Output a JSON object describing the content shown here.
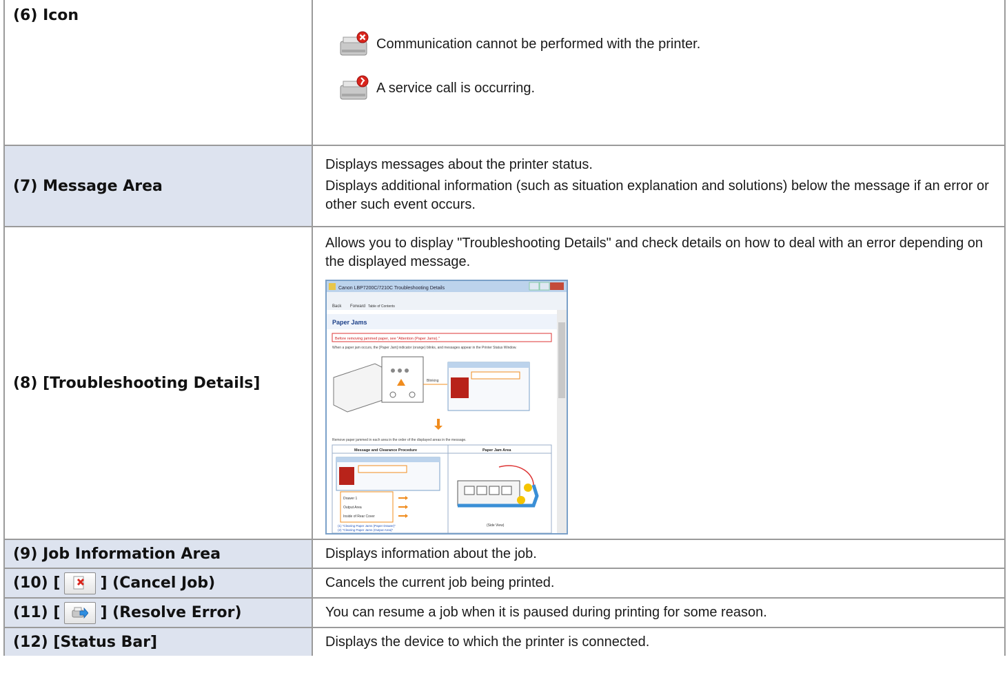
{
  "rows": {
    "icon": {
      "label": "(6) Icon",
      "items": [
        {
          "icon": "printer-error-x-icon",
          "text": "Communication cannot be performed with the printer."
        },
        {
          "icon": "printer-service-call-icon",
          "text": "A service call is occurring."
        }
      ]
    },
    "message_area": {
      "label": "(7) Message Area",
      "line1": "Displays messages about the printer status.",
      "line2": "Displays additional information (such as situation explanation and solutions) below the message if an error or other such event occurs."
    },
    "troubleshooting": {
      "label": "(8) [Troubleshooting Details]",
      "text": "Allows you to display \"Troubleshooting Details\" and check details on how to deal with an error depending on the displayed message.",
      "screenshot": {
        "window_title": "Canon LBP7200C/7210C Troubleshooting Details",
        "toolbar": [
          "Back",
          "Forward",
          "Table of Contents"
        ],
        "heading": "Paper Jams",
        "warning": "Before removing jammed paper, see \"Attention (Paper Jams).\"",
        "intro": "When a paper jam occurs, the [Paper Jam] indicator (orange) blinks, and messages appear in the Printer Status Window.",
        "blinking": "Blinking",
        "remove_text": "Remove paper jammed in each area in the order of the displayed areas in the message.",
        "col1": "Message and Clearance Procedure",
        "col2": "Paper Jam Area",
        "areas": [
          "Drawer 1",
          "Output Area",
          "Inside of Rear Cover"
        ],
        "links": [
          "(1) \"Clearing Paper Jams (Paper Drawer)\"",
          "(2) \"Clearing Paper Jams (Output Area)\""
        ],
        "side_view": "(Side View)"
      }
    },
    "job_info": {
      "label": "(9) Job Information Area",
      "text": "Displays information about the job."
    },
    "cancel_job": {
      "label_prefix": "(10) [",
      "label_suffix": "] (Cancel Job)",
      "icon": "cancel-job-icon",
      "text": "Cancels the current job being printed."
    },
    "resolve_error": {
      "label_prefix": "(11) [",
      "label_suffix": "] (Resolve Error)",
      "icon": "resolve-error-icon",
      "text": "You can resume a job when it is paused during printing for some reason."
    },
    "status_bar": {
      "label": "(12) [Status Bar]",
      "text": "Displays the device to which the printer is connected."
    }
  },
  "colors": {
    "label_shade": "#dde3ef",
    "border": "#9a9a9a",
    "error_red": "#d9251c"
  }
}
